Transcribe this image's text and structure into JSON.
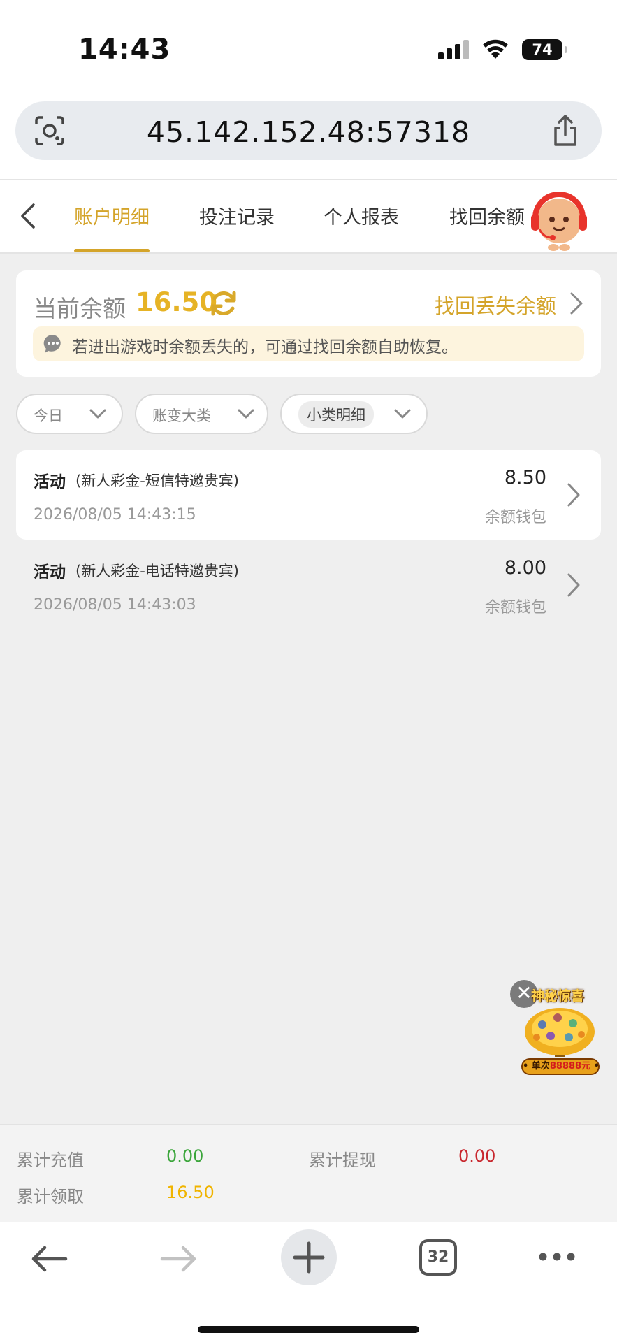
{
  "status_bar": {
    "time": "14:43",
    "battery": "74"
  },
  "browser": {
    "url": "45.142.152.48:57318",
    "tabs_count": "32"
  },
  "tabs": [
    {
      "label": "账户明细",
      "active": true
    },
    {
      "label": "投注记录",
      "active": false
    },
    {
      "label": "个人报表",
      "active": false
    },
    {
      "label": "找回余额",
      "active": false
    }
  ],
  "balance": {
    "label": "当前余额",
    "value": "16.50",
    "recover_link": "找回丢失余额",
    "tip": "若进出游戏时余额丢失的，可通过找回余额自助恢复。"
  },
  "filters": [
    {
      "label": "今日"
    },
    {
      "label": "账变大类"
    },
    {
      "label": "小类明细"
    }
  ],
  "records": [
    {
      "type": "活动",
      "subtype": "(新人彩金-短信特邀贵宾)",
      "time": "2026/08/05 14:43:15",
      "amount": "8.50",
      "wallet": "余额钱包"
    },
    {
      "type": "活动",
      "subtype": "(新人彩金-电话特邀贵宾)",
      "time": "2026/08/05 14:43:03",
      "amount": "8.00",
      "wallet": "余额钱包"
    }
  ],
  "promo": {
    "title": "神秘惊喜",
    "banner_prefix": "单次",
    "banner_amount": "88888元"
  },
  "summary": {
    "deposit_label": "累计充值",
    "deposit_value": "0.00",
    "withdraw_label": "累计提现",
    "withdraw_value": "0.00",
    "claimed_label": "累计领取",
    "claimed_value": "16.50"
  },
  "colors": {
    "accent": "#d4a42a",
    "balance": "#e6b325",
    "deposit": "#3aa53a",
    "withdraw": "#c8262d",
    "claimed": "#f0b400"
  }
}
